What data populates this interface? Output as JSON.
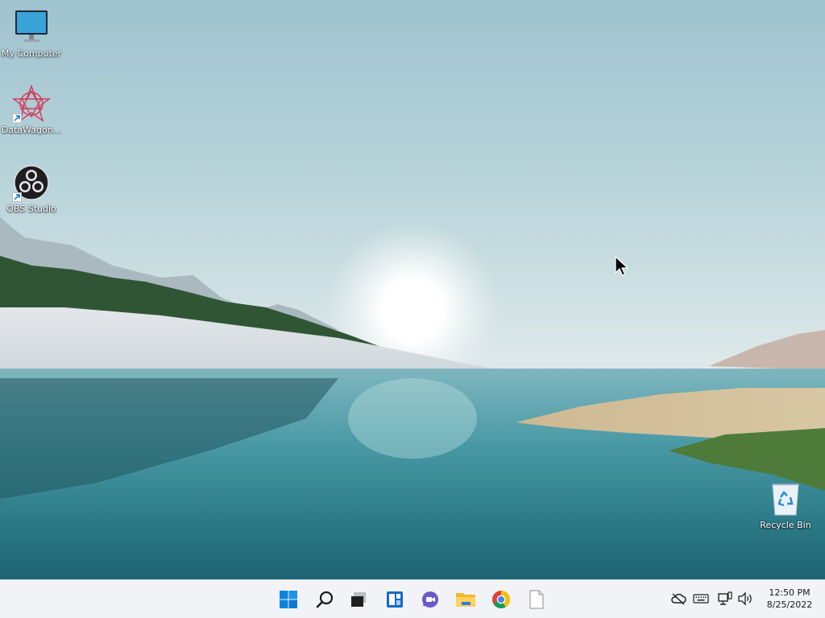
{
  "desktop": {
    "icons": [
      {
        "label": "My Computer",
        "icon": "monitor-icon"
      },
      {
        "label": "DataWagon...",
        "icon": "datawagon-icon",
        "shortcut": true
      },
      {
        "label": "OBS Studio",
        "icon": "obs-icon",
        "shortcut": true
      },
      {
        "label": "Recycle Bin",
        "icon": "recycle-bin-icon"
      }
    ]
  },
  "taskbar": {
    "pinned": [
      {
        "name": "start-button",
        "icon": "windows-logo-icon"
      },
      {
        "name": "search-button",
        "icon": "search-icon"
      },
      {
        "name": "task-view-button",
        "icon": "task-view-icon"
      },
      {
        "name": "widgets-button",
        "icon": "widgets-icon"
      },
      {
        "name": "chat-button",
        "icon": "teams-chat-icon"
      },
      {
        "name": "file-explorer-button",
        "icon": "folder-icon"
      },
      {
        "name": "chrome-button",
        "icon": "chrome-icon"
      },
      {
        "name": "blank-file-button",
        "icon": "document-icon"
      }
    ],
    "tray": [
      "onedrive-offline-icon",
      "keyboard-icon",
      "network-icon",
      "volume-icon"
    ],
    "clock": {
      "time": "12:50 PM",
      "date": "8/25/2022"
    }
  },
  "colors": {
    "taskbar_bg": "#f1f3f6",
    "accent": "#0078d4"
  }
}
